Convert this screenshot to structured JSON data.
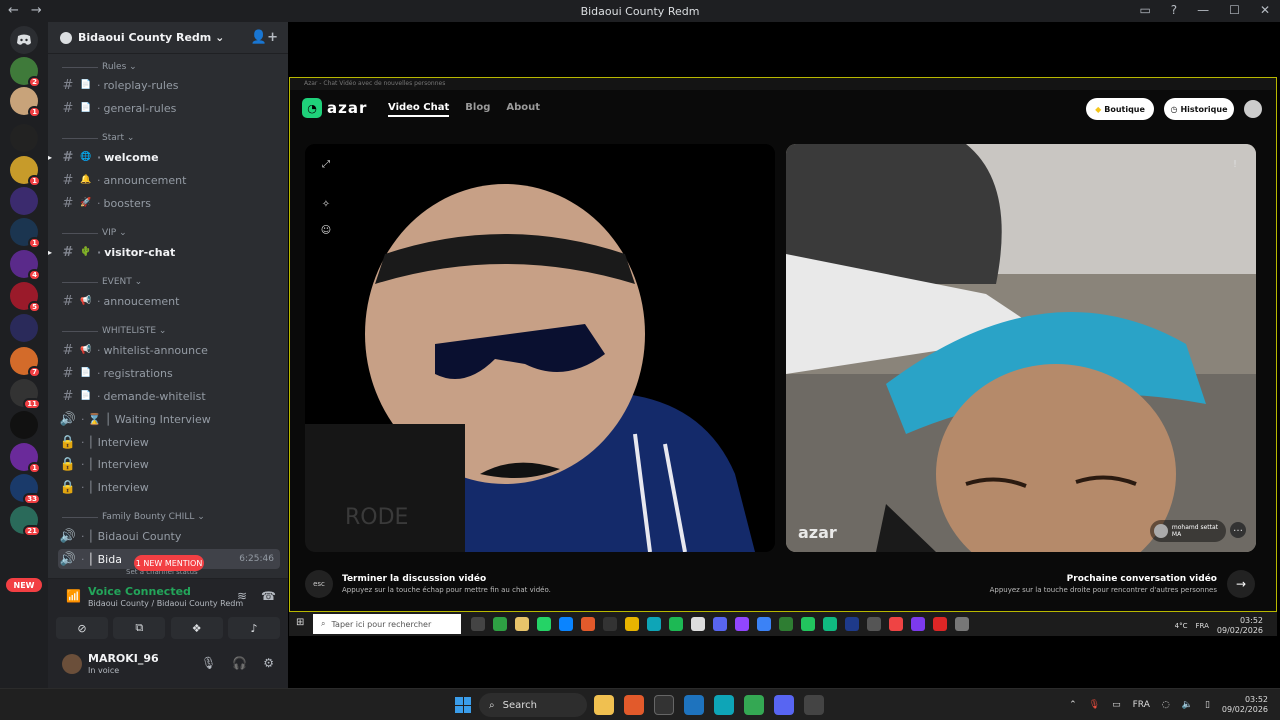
{
  "titlebar": {
    "title": "Bidaoui County Redm",
    "back": "←",
    "forward": "→"
  },
  "rail": {
    "servers": [
      {
        "name": "srv1",
        "badge": "2",
        "color": "#3f7a3a"
      },
      {
        "name": "srv2",
        "badge": "1",
        "color": "#c8a37a"
      },
      {
        "name": "srv3",
        "badge": "",
        "color": "#222"
      },
      {
        "name": "srv4",
        "badge": "1",
        "color": "#c79b2a"
      },
      {
        "name": "srv5",
        "badge": "",
        "color": "#3b2b6e"
      },
      {
        "name": "srv6",
        "badge": "1",
        "color": "#1b3550"
      },
      {
        "name": "srv7",
        "badge": "4",
        "color": "#5a2a8a"
      },
      {
        "name": "srv8",
        "badge": "5",
        "color": "#9a1a2a"
      },
      {
        "name": "srv9",
        "badge": "",
        "color": "#2a2a5a"
      },
      {
        "name": "srv10",
        "badge": "7",
        "color": "#d36b2a"
      },
      {
        "name": "srv11",
        "badge": "11",
        "color": "#333"
      },
      {
        "name": "srv12",
        "badge": "",
        "color": "#111"
      },
      {
        "name": "srv13",
        "badge": "1",
        "color": "#6a2a9a"
      },
      {
        "name": "srv14",
        "badge": "33",
        "color": "#1a3a6a"
      },
      {
        "name": "srv15",
        "badge": "21",
        "color": "#2a6a5a"
      }
    ],
    "new_label": "NEW"
  },
  "guild": {
    "name": "Bidaoui County Redm ⌄"
  },
  "categories": {
    "rules": "Rules ⌄",
    "start": "Start ⌄",
    "vip": "VIP ⌄",
    "event": "EVENT ⌄",
    "whiteliste": "WHITELISTE ⌄",
    "family": "Family Bounty CHILL ⌄"
  },
  "channels": [
    {
      "name": "roleplay-rules",
      "emoji": "📄"
    },
    {
      "name": "general-rules",
      "emoji": "📄"
    },
    {
      "name": "welcome",
      "emoji": "🌐"
    },
    {
      "name": "announcement",
      "emoji": "🔔"
    },
    {
      "name": "boosters",
      "emoji": "🚀"
    },
    {
      "name": "visitor-chat",
      "emoji": "🌵"
    },
    {
      "name": "annoucement",
      "emoji": "📢"
    },
    {
      "name": "whitelist-announce",
      "emoji": "📢"
    },
    {
      "name": "registrations",
      "emoji": "📄"
    },
    {
      "name": "demande-whitelist",
      "emoji": "📄"
    },
    {
      "name": "⌛ │ Waiting Interview",
      "emoji": "🔊"
    },
    {
      "name": "│ Interview",
      "emoji": "🔒"
    },
    {
      "name": "│ Interview",
      "emoji": "🔒"
    },
    {
      "name": "│ Interview",
      "emoji": "🔒"
    },
    {
      "name": "│ Bidaoui County",
      "emoji": "🔊"
    },
    {
      "name": "│ Bida",
      "emoji": "🔊"
    }
  ],
  "active_voice": {
    "time": "6:25:46",
    "mention": "1 NEW MENTION",
    "status_hint": "Set a channel status"
  },
  "voice": {
    "title": "Voice Connected",
    "sub": "Bidaoui County / Bidaoui County Redm"
  },
  "user": {
    "name": "MAROKI_96",
    "status": "In voice"
  },
  "azar": {
    "window_title": "Azar - Chat Vidéo avec de nouvelles personnes",
    "logo": "azar",
    "nav": [
      "Video Chat",
      "Blog",
      "About"
    ],
    "boutique": "Boutique",
    "historique": "Historique",
    "watermark": "azar",
    "peer_name": "mohamd settat",
    "peer_country": "MA",
    "end_title": "Terminer la discussion vidéo",
    "end_sub": "Appuyez sur la touche échap pour mettre fin au chat vidéo.",
    "esc": "esc",
    "next_title": "Prochaine conversation vidéo",
    "next_sub": "Appuyez sur la touche droite pour rencontrer d'autres personnes"
  },
  "inner_taskbar": {
    "search": "Taper ici pour rechercher",
    "weather": "4°C",
    "lang": "FRA",
    "time": "03:52",
    "date": "09/02/2026"
  },
  "taskbar": {
    "search": "Search",
    "lang": "FRA",
    "time": "03:52",
    "date": "09/02/2026"
  }
}
